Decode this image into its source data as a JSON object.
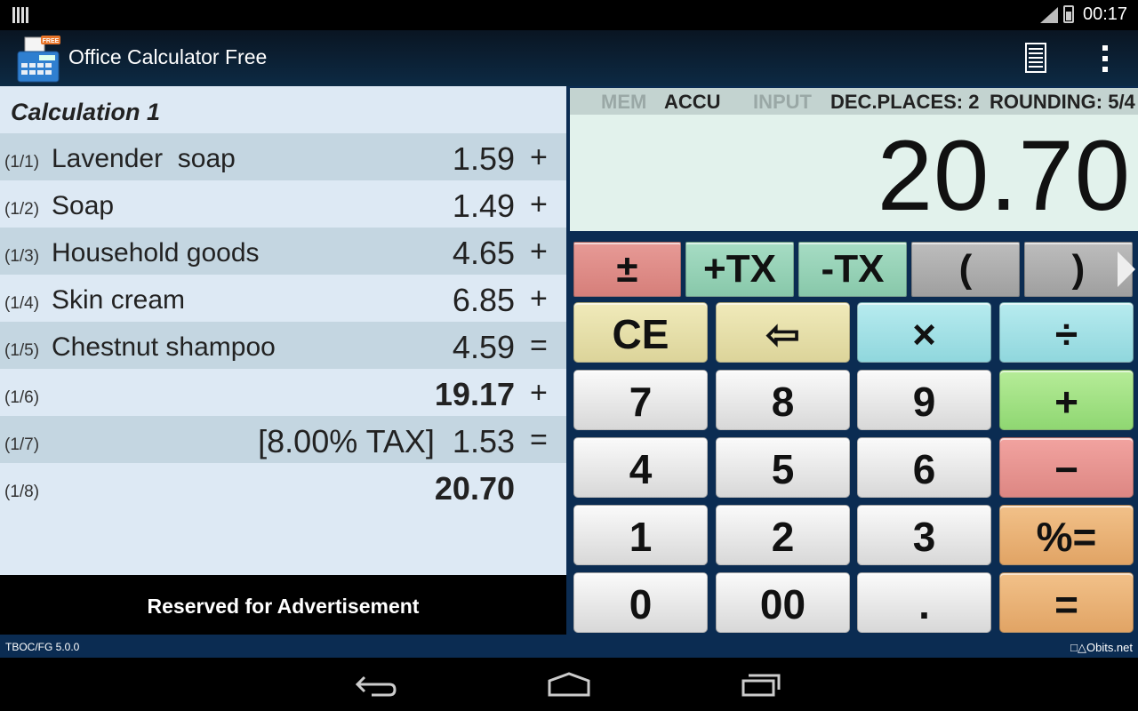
{
  "status_bar": {
    "time": "00:17"
  },
  "action_bar": {
    "app_title": "Office Calculator Free",
    "app_badge": "FREE"
  },
  "tape": {
    "title": "Calculation 1",
    "rows": [
      {
        "index": "(1/1)",
        "label": "Lavender  soap",
        "value": "1.59",
        "op": "+"
      },
      {
        "index": "(1/2)",
        "label": "Soap",
        "value": "1.49",
        "op": "+"
      },
      {
        "index": "(1/3)",
        "label": "Household goods",
        "value": "4.65",
        "op": "+"
      },
      {
        "index": "(1/4)",
        "label": "Skin cream",
        "value": "6.85",
        "op": "+"
      },
      {
        "index": "(1/5)",
        "label": "Chestnut shampoo",
        "value": "4.59",
        "op": "="
      },
      {
        "index": "(1/6)",
        "label": "",
        "value": "19.17",
        "op": "+"
      },
      {
        "index": "(1/7)",
        "label": "",
        "value": "[8.00% TAX]  1.53",
        "op": "="
      },
      {
        "index": "(1/8)",
        "label": "",
        "value": "20.70",
        "op": ""
      }
    ]
  },
  "advertisement": "Reserved for Advertisement",
  "calculator": {
    "status": {
      "mem": "MEM",
      "accu": "ACCU",
      "input": "INPUT",
      "dec_places": "DEC.PLACES: 2",
      "rounding": "ROUNDING: 5/4"
    },
    "display": "20.70",
    "function_keys": [
      "±",
      "+TX",
      "-TX",
      "(",
      ")"
    ],
    "keys": {
      "ce": "CE",
      "backspace": "⇦",
      "multiply": "×",
      "divide": "÷",
      "k7": "7",
      "k8": "8",
      "k9": "9",
      "plus": "+",
      "k4": "4",
      "k5": "5",
      "k6": "6",
      "minus": "−",
      "k1": "1",
      "k2": "2",
      "k3": "3",
      "percent_eq": "%=",
      "k0": "0",
      "k00": "00",
      "dot": ".",
      "equals": "="
    }
  },
  "footer": {
    "version": "TBOC/FG 5.0.0",
    "brand": "□△Obits.net"
  },
  "colors": {
    "tape_bg": "#dde9f4",
    "tape_alt": "#c4d6e1",
    "calc_bg": "#0b2c52",
    "display_bg": "#e2f2ec",
    "key_red": "#e79a96",
    "key_teal": "#a6dcc4",
    "key_yellow": "#f0eaba",
    "key_cyan": "#b7ebef",
    "key_green": "#b6ec98",
    "key_orange": "#f2c189"
  }
}
